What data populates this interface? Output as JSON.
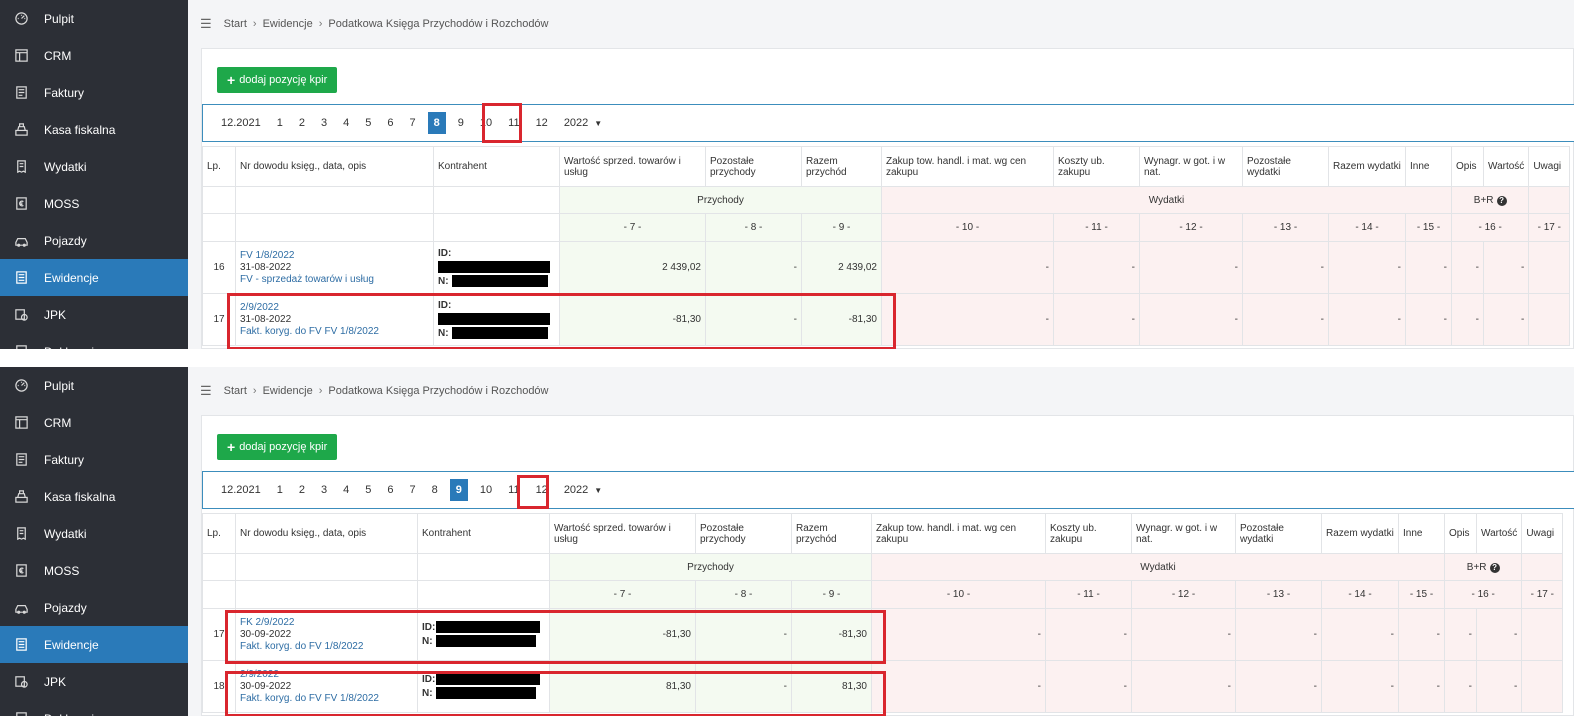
{
  "sidebar": {
    "items": [
      {
        "label": "Pulpit",
        "icon": "dashboard-icon"
      },
      {
        "label": "CRM",
        "icon": "layout-icon"
      },
      {
        "label": "Faktury",
        "icon": "invoice-icon"
      },
      {
        "label": "Kasa fiskalna",
        "icon": "cash-register-icon"
      },
      {
        "label": "Wydatki",
        "icon": "receipt-icon"
      },
      {
        "label": "MOSS",
        "icon": "euro-icon"
      },
      {
        "label": "Pojazdy",
        "icon": "car-icon"
      },
      {
        "label": "Ewidencje",
        "icon": "ledger-icon"
      },
      {
        "label": "JPK",
        "icon": "jpk-icon"
      },
      {
        "label": "Deklaracje",
        "icon": "declaration-icon"
      }
    ],
    "active": "Ewidencje"
  },
  "breadcrumb": {
    "items": [
      "Start",
      "Ewidencje",
      "Podatkowa Księga Przychodów i Rozchodów"
    ]
  },
  "add_button": "dodaj pozycję kpir",
  "months": [
    "12.2021",
    "1",
    "2",
    "3",
    "4",
    "5",
    "6",
    "7",
    "8",
    "9",
    "10",
    "11",
    "12"
  ],
  "year": "2022",
  "table": {
    "headers": {
      "lp": "Lp.",
      "nr": "Nr dowodu księg., data, opis",
      "kontrahent": "Kontrahent",
      "c7": "Wartość sprzed. towarów i usług",
      "c8": "Pozostałe przychody",
      "c9": "Razem przychód",
      "c10": "Zakup tow. handl. i mat. wg cen zakupu",
      "c11": "Koszty ub. zakupu",
      "c12": "Wynagr. w got. i w nat.",
      "c13": "Pozostałe wydatki",
      "c14": "Razem wydatki",
      "c15": "Inne",
      "c16a": "Opis",
      "c16b": "Wartość",
      "c17": "Uwagi"
    },
    "group_przychody": "Przychody",
    "group_wydatki": "Wydatki",
    "br_label": "B+R",
    "col_nums": [
      "- 7 -",
      "- 8 -",
      "- 9 -",
      "- 10 -",
      "- 11 -",
      "- 12 -",
      "- 13 -",
      "- 14 -",
      "- 15 -",
      "- 16 -",
      "- 17 -"
    ],
    "id_label": "ID:",
    "n_label": "N:",
    "dash": "-"
  },
  "panel1": {
    "active_month": "8",
    "rows": [
      {
        "lp": "16",
        "doc": "FV 1/8/2022",
        "date": "31-08-2022",
        "desc": "FV - sprzedaż towarów i usług",
        "c7": "2 439,02",
        "c8": "-",
        "c9": "2 439,02"
      },
      {
        "lp": "17",
        "doc": "2/9/2022",
        "date": "31-08-2022",
        "desc": "Fakt. koryg. do FV FV 1/8/2022",
        "c7": "-81,30",
        "c8": "-",
        "c9": "-81,30"
      }
    ]
  },
  "panel2": {
    "active_month": "9",
    "rows": [
      {
        "lp": "17",
        "doc": "FK 2/9/2022",
        "date": "30-09-2022",
        "desc": "Fakt. koryg. do FV 1/8/2022",
        "c7": "-81,30",
        "c8": "-",
        "c9": "-81,30"
      },
      {
        "lp": "18",
        "doc": "2/9/2022",
        "date": "30-09-2022",
        "desc": "Fakt. koryg. do FV FV 1/8/2022",
        "c7": "81,30",
        "c8": "-",
        "c9": "81,30"
      }
    ]
  },
  "colors": {
    "sidebar": "#2c2f36",
    "active": "#2a7ab9",
    "add_button": "#1ea84a",
    "highlight": "#d9262e",
    "income_bg": "#f4faf1",
    "expense_bg": "#fcf1f1"
  }
}
